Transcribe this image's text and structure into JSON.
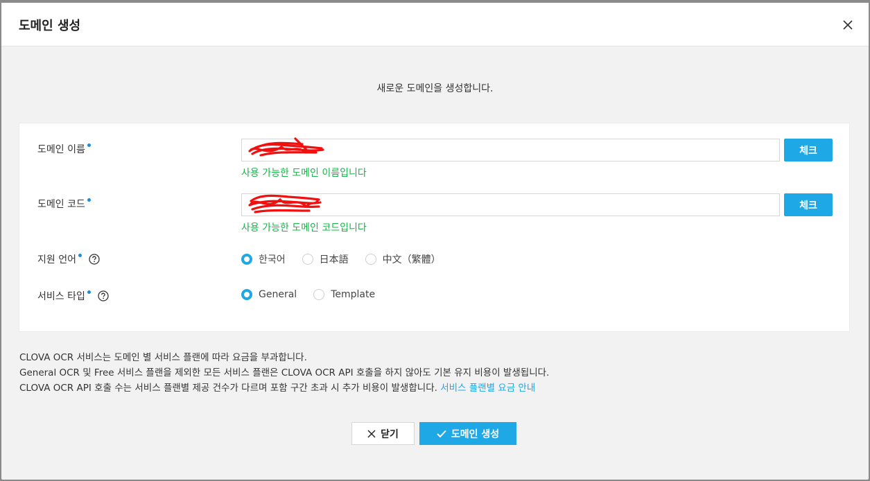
{
  "modal": {
    "title": "도메인 생성",
    "intro": "새로운 도메인을 생성합니다."
  },
  "form": {
    "domain_name": {
      "label": "도메인 이름",
      "value": "",
      "check_label": "체크",
      "valid_message": "사용 가능한 도메인 이름입니다"
    },
    "domain_code": {
      "label": "도메인 코드",
      "value": "",
      "check_label": "체크",
      "valid_message": "사용 가능한 도메인 코드입니다"
    },
    "language": {
      "label": "지원 언어",
      "options": [
        {
          "label": "한국어",
          "selected": true
        },
        {
          "label": "日本語",
          "selected": false
        },
        {
          "label": "中文（繁體）",
          "selected": false
        }
      ]
    },
    "service_type": {
      "label": "서비스 타입",
      "options": [
        {
          "label": "General",
          "selected": true
        },
        {
          "label": "Template",
          "selected": false
        }
      ]
    }
  },
  "notes": {
    "line1": "CLOVA OCR 서비스는 도메인 별 서비스 플랜에 따라 요금을 부과합니다.",
    "line2": "General OCR 및 Free 서비스 플랜을 제외한 모든 서비스 플랜은 CLOVA OCR API 호출을 하지 않아도 기본 유지 비용이 발생됩니다.",
    "line3": "CLOVA OCR API 호출 수는 서비스 플랜별 제공 건수가 다르며 포함 구간 초과 시 추가 비용이 발생합니다.",
    "link": "서비스 플랜별 요금 안내"
  },
  "footer": {
    "close_label": "닫기",
    "create_label": "도메인 생성"
  },
  "colors": {
    "accent": "#1fa8e6",
    "success": "#16b44a",
    "required_dot": "#1a8fd8"
  }
}
